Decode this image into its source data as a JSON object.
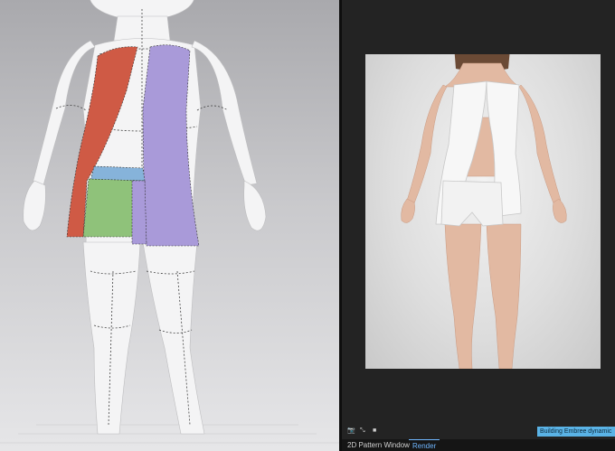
{
  "tabs": [
    {
      "label": "2D Pattern Window",
      "active": false
    },
    {
      "label": "Render",
      "active": true
    }
  ],
  "render_toolbar": {
    "buttons": [
      {
        "icon": "camera-icon",
        "label": "📷"
      },
      {
        "icon": "scale-icon",
        "label": "⤡"
      },
      {
        "icon": "stop-icon",
        "label": "■"
      }
    ],
    "status_text": "Building Embree dynamic"
  },
  "colors": {
    "pattern_red": "#cf5a45",
    "pattern_purple": "#a99ad9",
    "pattern_green": "#8fc27a",
    "pattern_blue": "#86b3da",
    "accent": "#5ab3e6"
  }
}
